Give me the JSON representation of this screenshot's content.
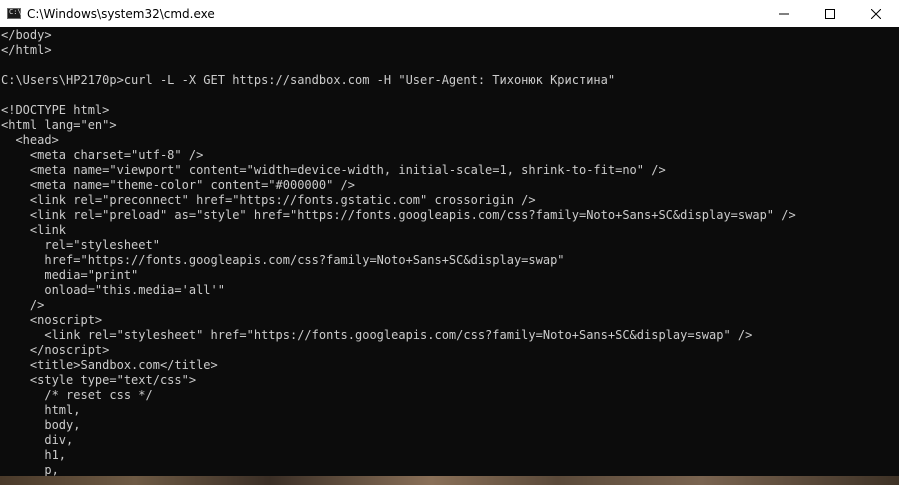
{
  "window": {
    "title": "C:\\Windows\\system32\\cmd.exe",
    "icon": "cmd-icon",
    "icon_glyph": "C:\\",
    "controls": [
      "minimize-icon",
      "maximize-icon",
      "close-icon"
    ]
  },
  "console": {
    "text_color": "#cccccc",
    "background_color": "#0c0c0c",
    "lines": [
      "</body>",
      "</html>",
      "",
      "C:\\Users\\HP2170p>curl -L -X GET https://sandbox.com -H \"User-Agent: Тихонюк Кристина\"",
      "",
      "<!DOCTYPE html>",
      "<html lang=\"en\">",
      "  <head>",
      "    <meta charset=\"utf-8\" />",
      "    <meta name=\"viewport\" content=\"width=device-width, initial-scale=1, shrink-to-fit=no\" />",
      "    <meta name=\"theme-color\" content=\"#000000\" />",
      "    <link rel=\"preconnect\" href=\"https://fonts.gstatic.com\" crossorigin />",
      "    <link rel=\"preload\" as=\"style\" href=\"https://fonts.googleapis.com/css?family=Noto+Sans+SC&display=swap\" />",
      "    <link",
      "      rel=\"stylesheet\"",
      "      href=\"https://fonts.googleapis.com/css?family=Noto+Sans+SC&display=swap\"",
      "      media=\"print\"",
      "      onload=\"this.media='all'\"",
      "    />",
      "    <noscript>",
      "      <link rel=\"stylesheet\" href=\"https://fonts.googleapis.com/css?family=Noto+Sans+SC&display=swap\" />",
      "    </noscript>",
      "    <title>Sandbox.com</title>",
      "    <style type=\"text/css\">",
      "      /* reset css */",
      "      html,",
      "      body,",
      "      div,",
      "      h1,",
      "      p,"
    ]
  }
}
